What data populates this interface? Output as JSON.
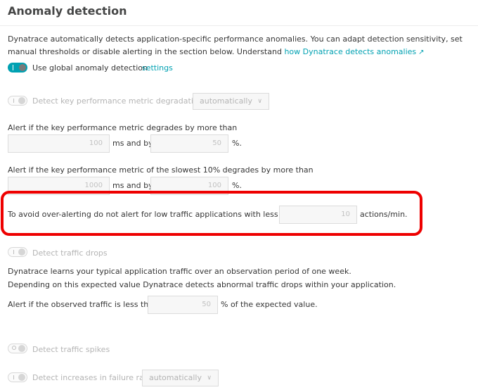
{
  "page": {
    "title": "Anomaly detection"
  },
  "intro": {
    "text": "Dynatrace automatically detects application-specific performance anomalies. You can adapt detection sensitivity, set manual thresholds or disable alerting in the section below. Understand ",
    "link": "how Dynatrace detects anomalies"
  },
  "global": {
    "label": "Use global anomaly detection",
    "settings_link": "settings",
    "enabled": true
  },
  "key_metric": {
    "toggle_label": "Detect key performance metric degradations",
    "mode": "automatically",
    "rule1": {
      "label": "Alert if the key performance metric degrades by more than",
      "ms_value": "100",
      "ms_and_by": "ms and by",
      "pct_value": "50",
      "pct_unit": "%."
    },
    "rule2": {
      "label": "Alert if the key performance metric of the slowest 10% degrades by more than",
      "ms_value": "1000",
      "ms_and_by": "ms and by",
      "pct_value": "100",
      "pct_unit": "%."
    },
    "low_traffic": {
      "label": "To avoid over-alerting do not alert for low traffic applications with less than",
      "value": "10",
      "unit": "actions/min."
    }
  },
  "traffic_drops": {
    "toggle_label": "Detect traffic drops",
    "desc1": "Dynatrace learns your typical application traffic over an observation period of one week.",
    "desc2": "Depending on this expected value Dynatrace detects abnormal traffic drops within your application.",
    "alert_label": "Alert if the observed traffic is less than",
    "value": "50",
    "suffix": "% of the expected value."
  },
  "traffic_spikes": {
    "toggle_label": "Detect traffic spikes"
  },
  "failure_rate": {
    "toggle_label": "Detect increases in failure rate",
    "mode": "automatically"
  },
  "colors": {
    "accent": "#00a1b2",
    "highlight": "#ee0000",
    "disabled_text": "#b4b4b4"
  }
}
